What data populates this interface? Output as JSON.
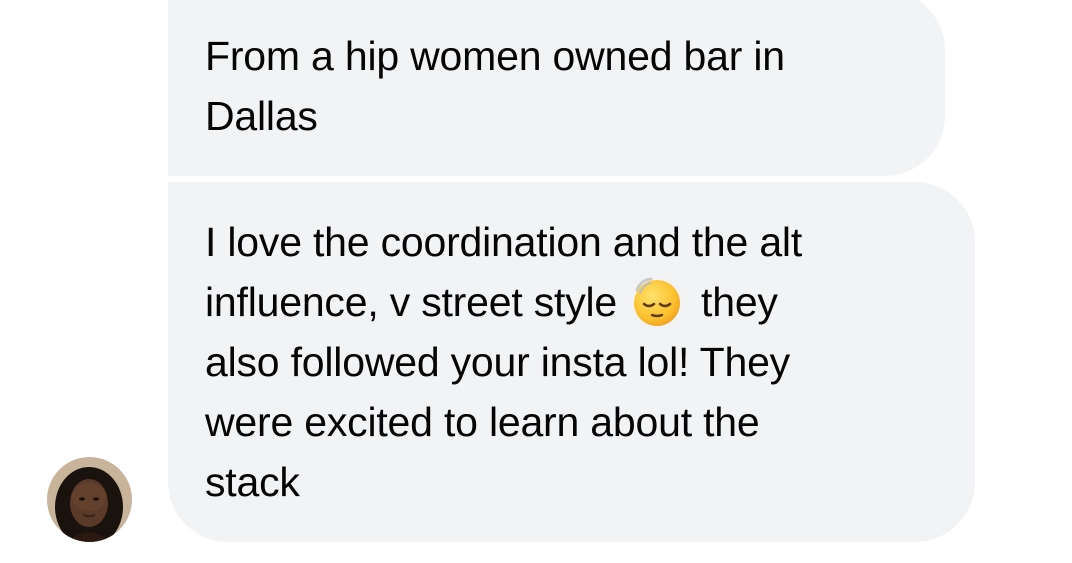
{
  "messages": [
    {
      "lines": [
        "From a hip women owned bar in",
        "Dallas"
      ]
    },
    {
      "lines": [
        "I love the coordination and the alt",
        "influence, v street style",
        "they",
        "also followed your insta lol! They",
        "were excited to learn about the",
        "stack"
      ],
      "emoji": "relieved-face-emoji"
    }
  ],
  "colors": {
    "bubble_background": "#f2f3f5",
    "text": "#050505",
    "page_background": "#ffffff"
  },
  "avatar": {
    "icon": "user-avatar"
  }
}
